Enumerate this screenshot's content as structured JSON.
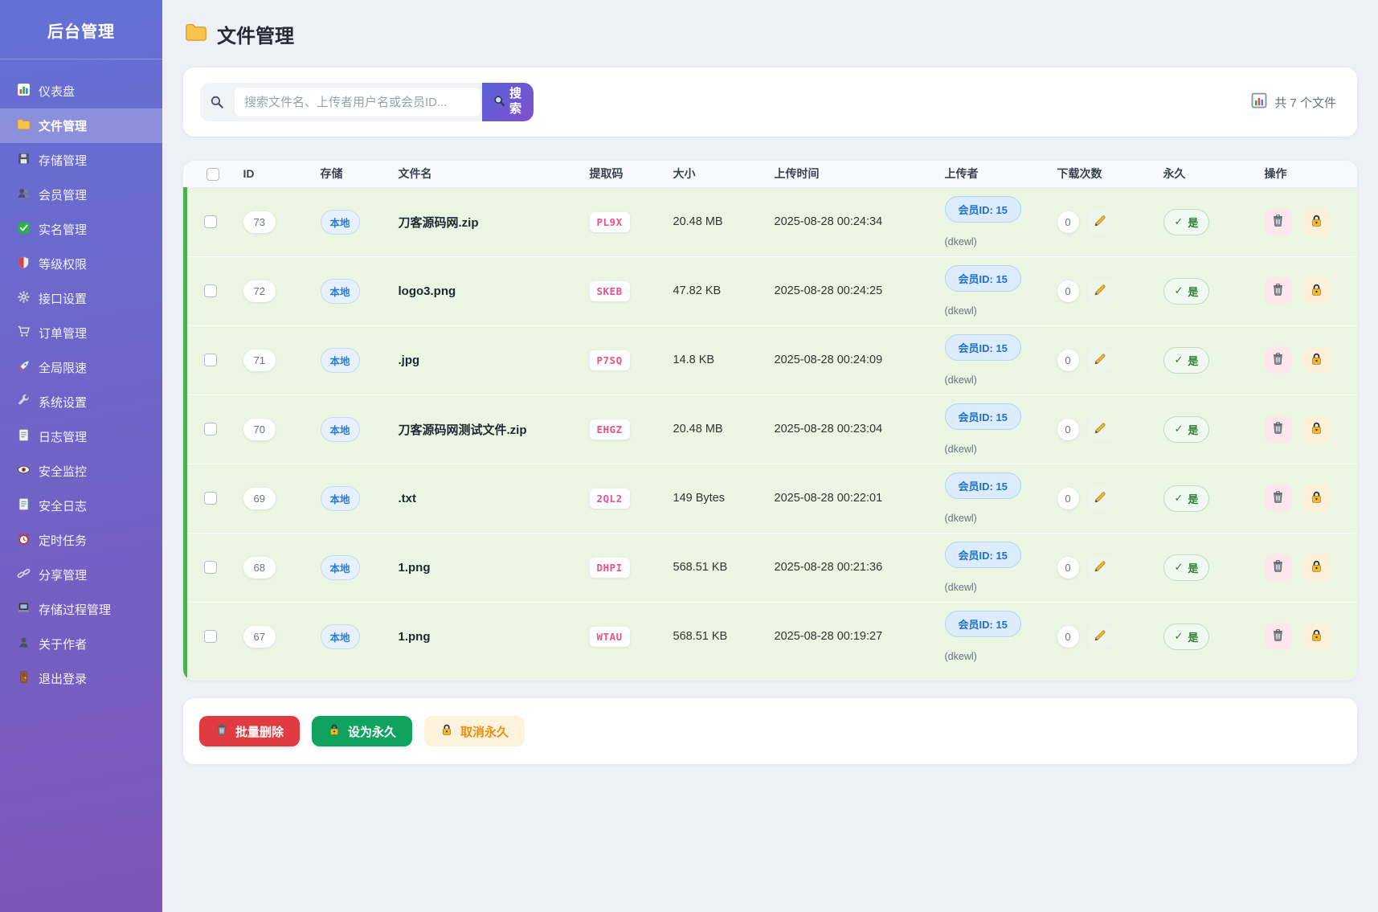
{
  "app": {
    "title": "后台管理"
  },
  "sidebar": {
    "items": [
      {
        "label": "仪表盘",
        "icon": "bar-chart-icon",
        "active": false
      },
      {
        "label": "文件管理",
        "icon": "folder-icon",
        "active": true
      },
      {
        "label": "存储管理",
        "icon": "floppy-disk-icon",
        "active": false
      },
      {
        "label": "会员管理",
        "icon": "users-icon",
        "active": false
      },
      {
        "label": "实名管理",
        "icon": "check-square-icon",
        "active": false
      },
      {
        "label": "等级权限",
        "icon": "shield-icon",
        "active": false
      },
      {
        "label": "接口设置",
        "icon": "gear-icon",
        "active": false
      },
      {
        "label": "订单管理",
        "icon": "cart-icon",
        "active": false
      },
      {
        "label": "全局限速",
        "icon": "rocket-icon",
        "active": false
      },
      {
        "label": "系统设置",
        "icon": "wrench-icon",
        "active": false
      },
      {
        "label": "日志管理",
        "icon": "document-icon",
        "active": false
      },
      {
        "label": "安全监控",
        "icon": "eye-icon",
        "active": false
      },
      {
        "label": "安全日志",
        "icon": "document-icon",
        "active": false
      },
      {
        "label": "定时任务",
        "icon": "alarm-clock-icon",
        "active": false
      },
      {
        "label": "分享管理",
        "icon": "link-icon",
        "active": false
      },
      {
        "label": "存储过程管理",
        "icon": "laptop-icon",
        "active": false
      },
      {
        "label": "关于作者",
        "icon": "person-icon",
        "active": false
      },
      {
        "label": "退出登录",
        "icon": "door-icon",
        "active": false
      }
    ]
  },
  "page": {
    "title": "文件管理"
  },
  "search": {
    "placeholder": "搜索文件名、上传者用户名或会员ID...",
    "button_label": "搜索",
    "file_count": "共 7 个文件"
  },
  "table": {
    "columns": [
      "ID",
      "存储",
      "文件名",
      "提取码",
      "大小",
      "上传时间",
      "上传者",
      "下载次数",
      "永久",
      "操作"
    ],
    "permanent_check": "✓",
    "rows": [
      {
        "id": "73",
        "storage": "本地",
        "filename": "刀客源码网.zip",
        "code": "PL9X",
        "size": "20.48 MB",
        "time": "2025-08-28 00:24:34",
        "member": "会员ID: 15",
        "uploader": "(dkewl)",
        "downloads": "0",
        "permanent": "是"
      },
      {
        "id": "72",
        "storage": "本地",
        "filename": "logo3.png",
        "code": "SKEB",
        "size": "47.82 KB",
        "time": "2025-08-28 00:24:25",
        "member": "会员ID: 15",
        "uploader": "(dkewl)",
        "downloads": "0",
        "permanent": "是"
      },
      {
        "id": "71",
        "storage": "本地",
        "filename": ".jpg",
        "code": "P7SQ",
        "size": "14.8 KB",
        "time": "2025-08-28 00:24:09",
        "member": "会员ID: 15",
        "uploader": "(dkewl)",
        "downloads": "0",
        "permanent": "是"
      },
      {
        "id": "70",
        "storage": "本地",
        "filename": "刀客源码网测试文件.zip",
        "code": "EHGZ",
        "size": "20.48 MB",
        "time": "2025-08-28 00:23:04",
        "member": "会员ID: 15",
        "uploader": "(dkewl)",
        "downloads": "0",
        "permanent": "是"
      },
      {
        "id": "69",
        "storage": "本地",
        "filename": ".txt",
        "code": "2QL2",
        "size": "149 Bytes",
        "time": "2025-08-28 00:22:01",
        "member": "会员ID: 15",
        "uploader": "(dkewl)",
        "downloads": "0",
        "permanent": "是"
      },
      {
        "id": "68",
        "storage": "本地",
        "filename": "1.png",
        "code": "DHPI",
        "size": "568.51 KB",
        "time": "2025-08-28 00:21:36",
        "member": "会员ID: 15",
        "uploader": "(dkewl)",
        "downloads": "0",
        "permanent": "是"
      },
      {
        "id": "67",
        "storage": "本地",
        "filename": "1.png",
        "code": "WTAU",
        "size": "568.51 KB",
        "time": "2025-08-28 00:19:27",
        "member": "会员ID: 15",
        "uploader": "(dkewl)",
        "downloads": "0",
        "permanent": "是"
      }
    ]
  },
  "footer": {
    "delete_label": "批量删除",
    "set_permanent_label": "设为永久",
    "cancel_permanent_label": "取消永久"
  },
  "colors": {
    "sidebar-top": "#6471d6",
    "sidebar-bottom": "#7d56b8",
    "accent-green": "#4caf50",
    "row-bg": "#eaf5e2",
    "btn-red": "#e03b41",
    "btn-green": "#0fa35f",
    "btn-cream": "#fdf3dd",
    "btn-orange-text": "#ee8e0b",
    "search-grad-1": "#5a60da",
    "search-grad-2": "#7d52cc",
    "link-blue": "#2d7dd2",
    "code-pink": "#e8538c"
  }
}
